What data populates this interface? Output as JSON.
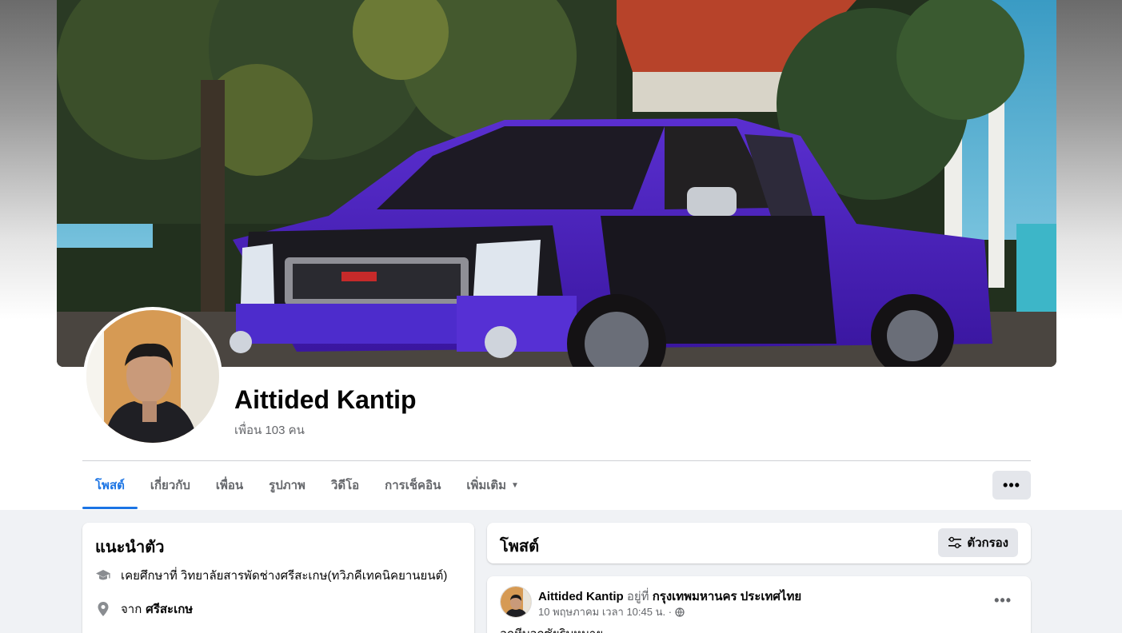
{
  "profile": {
    "name": "Aittided Kantip",
    "friends": "เพื่อน 103 คน"
  },
  "tabs": [
    {
      "label": "โพสต์"
    },
    {
      "label": "เกี่ยวกับ"
    },
    {
      "label": "เพื่อน"
    },
    {
      "label": "รูปภาพ"
    },
    {
      "label": "วิดีโอ"
    },
    {
      "label": "การเช็คอิน"
    },
    {
      "label": "เพิ่มเติม"
    }
  ],
  "more_button": "•••",
  "intro": {
    "title": "แนะนำตัว",
    "education": "เคยศึกษาที่ วิทยาลัยสารพัดช่างศรีสะเกษ(ทวิภคีเทคนิคยานยนต์)",
    "from_label": "จาก",
    "from_value": "ศรีสะเกษ"
  },
  "posts": {
    "title": "โพสต์",
    "filter_label": "ตัวกรอง"
  },
  "post": {
    "author": "Aittided Kantip",
    "at_label": "อยู่ที่",
    "location": "กรุงเทพมหานคร ประเทศไทย",
    "timestamp": "10 พฤษภาคม เวลา 10:45 น. ·",
    "menu": "•••",
    "text": "อกหีบอกซัยริบหมาย"
  },
  "colors": {
    "accent": "#1b74e4",
    "truck": "#4b1fb8"
  },
  "icons": {
    "education": "graduation-cap-icon",
    "location": "map-pin-icon",
    "filter": "filter-sliders-icon",
    "privacy": "globe-icon",
    "caret": "caret-down-icon"
  }
}
